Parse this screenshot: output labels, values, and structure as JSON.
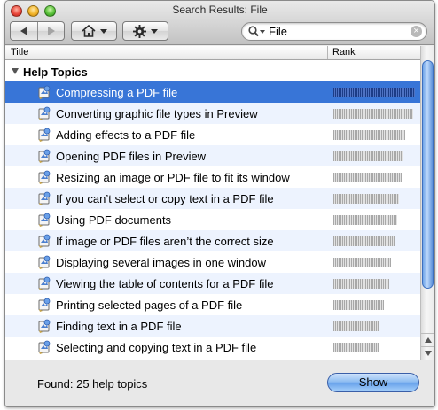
{
  "window": {
    "title": "Search Results: File"
  },
  "toolbar": {
    "back_icon": "back-arrow-icon",
    "forward_icon": "forward-arrow-icon",
    "home_icon": "home-icon",
    "action_icon": "gear-icon"
  },
  "search": {
    "value": "File",
    "icon": "search-icon"
  },
  "columns": {
    "title": "Title",
    "rank": "Rank"
  },
  "list": {
    "group_label": "Help Topics",
    "rows": [
      {
        "label": "Compressing a PDF file",
        "rank": 1.0,
        "selected": true
      },
      {
        "label": "Converting graphic file types in Preview",
        "rank": 0.98
      },
      {
        "label": "Adding effects to a PDF file",
        "rank": 0.88
      },
      {
        "label": "Opening PDF files in Preview",
        "rank": 0.86
      },
      {
        "label": "Resizing an image or PDF file to fit its window",
        "rank": 0.84
      },
      {
        "label": "If you can’t select or copy text in a PDF file",
        "rank": 0.8
      },
      {
        "label": "Using PDF documents",
        "rank": 0.78
      },
      {
        "label": "If image or PDF files aren’t the correct size",
        "rank": 0.76
      },
      {
        "label": "Displaying several images in one window",
        "rank": 0.71
      },
      {
        "label": "Viewing the table of contents for a PDF file",
        "rank": 0.69
      },
      {
        "label": "Printing selected pages of a PDF file",
        "rank": 0.62
      },
      {
        "label": "Finding text in a PDF file",
        "rank": 0.57
      },
      {
        "label": "Selecting and copying text in a PDF file",
        "rank": 0.55
      }
    ]
  },
  "footer": {
    "found_text": "Found: 25 help topics",
    "show_label": "Show"
  },
  "colors": {
    "selection": "#3875d7",
    "alt_row": "#edf3fe",
    "rank_bar": "#a8a8a8"
  }
}
